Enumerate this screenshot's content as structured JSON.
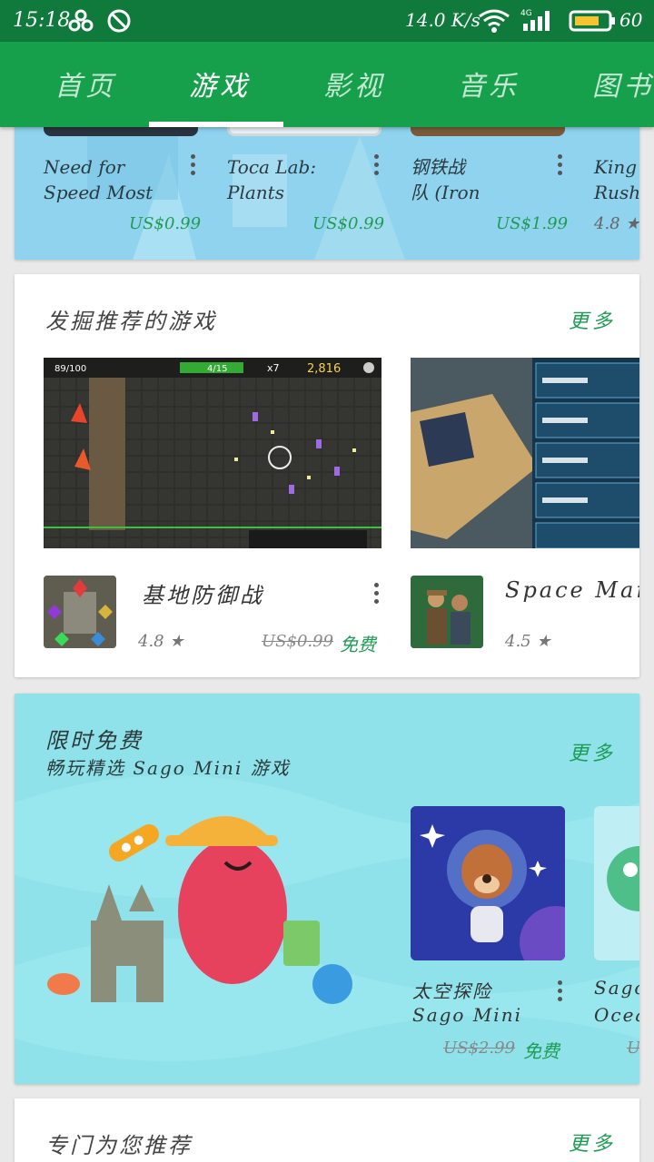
{
  "status_bar": {
    "time": "15:18",
    "net_speed": "14.0 K/s",
    "network_type": "4G",
    "battery": "60"
  },
  "tabs": [
    {
      "label": "首页"
    },
    {
      "label": "游戏"
    },
    {
      "label": "影视"
    },
    {
      "label": "音乐"
    },
    {
      "label": "图书"
    }
  ],
  "top_row": {
    "items": [
      {
        "title_line1": "Need for",
        "title_line2": "Speed Most",
        "price": "US$0.99"
      },
      {
        "title_line1": "Toca Lab:",
        "title_line2": "Plants",
        "price": "US$0.99"
      },
      {
        "title_line1": "钢铁战",
        "title_line2": "队 (Iron",
        "price": "US$1.99"
      },
      {
        "title_line1": "King",
        "title_line2": "Rush",
        "rating": "4.8"
      }
    ]
  },
  "discover": {
    "title": "发掘推荐的游戏",
    "more": "更多",
    "apps": [
      {
        "name": "基地防御战",
        "rating": "4.8",
        "old_price": "US$0.99",
        "price": "免费"
      },
      {
        "name": "Space Mar",
        "rating": "4.5"
      }
    ],
    "hud": {
      "hp": "89/100",
      "wave": "4/15",
      "mult": "x7",
      "coins": "2,816"
    }
  },
  "limited_free": {
    "title": "限时免费",
    "subtitle": "畅玩精选 Sago Mini 游戏",
    "more": "更多",
    "apps": [
      {
        "name_line1": "太空探险",
        "name_line2": "Sago Mini",
        "old_price": "US$2.99",
        "price": "免费"
      },
      {
        "name_line1": "Sago",
        "name_line2": "Ocea",
        "old_price": "U"
      }
    ]
  },
  "for_you": {
    "title": "专门为您推荐",
    "more": "更多"
  },
  "colors": {
    "status_bar": "#0f7a3b",
    "tab_bar": "#17a04c",
    "accent_green": "#1f9c53"
  }
}
